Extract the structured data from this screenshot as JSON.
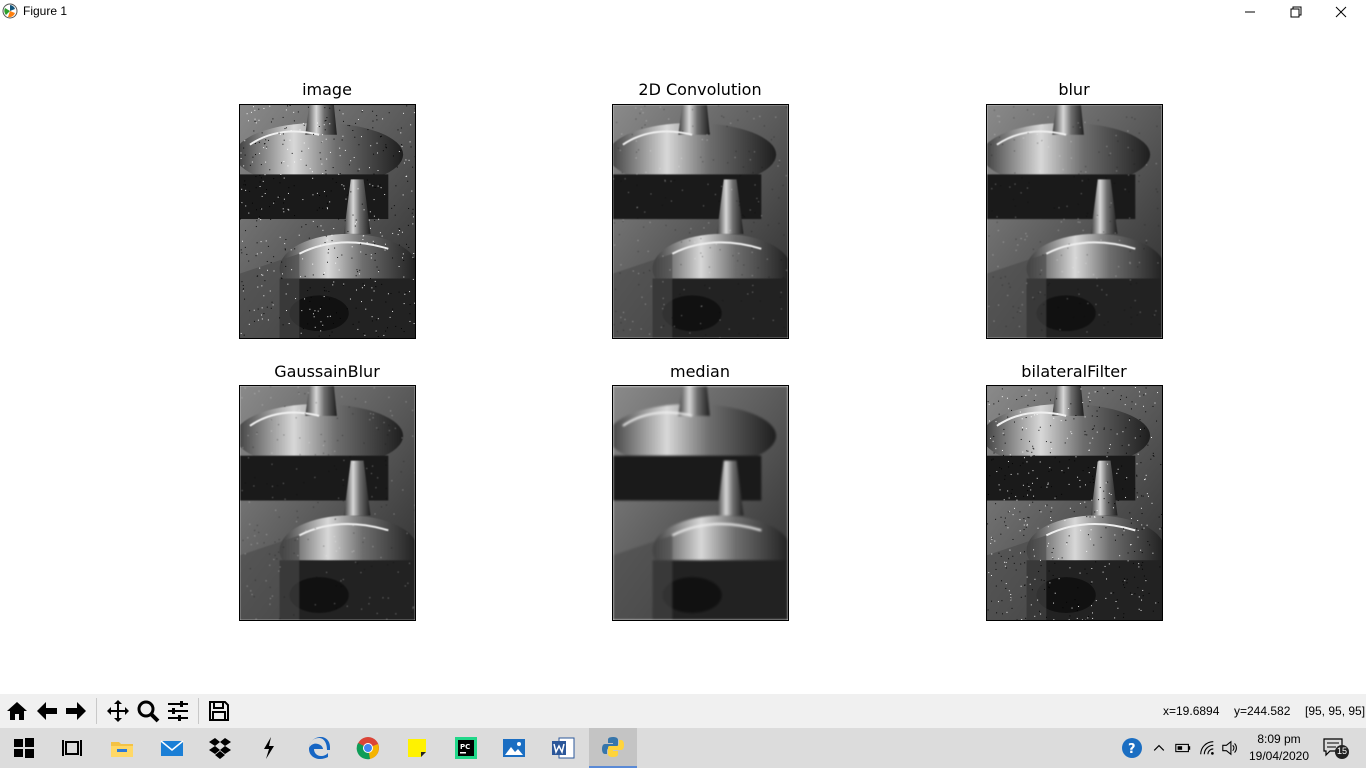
{
  "window": {
    "title": "Figure 1"
  },
  "subplots": [
    {
      "title": "image",
      "variant": "noisy"
    },
    {
      "title": "2D Convolution",
      "variant": "soft-noisy"
    },
    {
      "title": "blur",
      "variant": "soft-noisy"
    },
    {
      "title": "GaussainBlur",
      "variant": "soft-noisy"
    },
    {
      "title": "median",
      "variant": "clean"
    },
    {
      "title": "bilateralFilter",
      "variant": "noisy"
    }
  ],
  "toolbar": {
    "buttons": [
      "home-icon",
      "back-icon",
      "forward-icon",
      "pan-icon",
      "zoom-icon",
      "configure-subplots-icon",
      "save-icon"
    ],
    "status": {
      "x": "x=19.6894",
      "y": "y=244.582",
      "pixel": "[95, 95, 95]"
    }
  },
  "taskbar": {
    "apps": [
      "start-icon",
      "task-view-icon",
      "file-explorer-icon",
      "mail-icon",
      "dropbox-icon",
      "code-editor-icon",
      "edge-icon",
      "chrome-icon",
      "sticky-notes-icon",
      "pycharm-icon",
      "photos-icon",
      "word-icon",
      "python-icon"
    ],
    "clock_time": "8:09 pm",
    "clock_date": "19/04/2020",
    "notification_count": "15"
  },
  "colors": {
    "toolbar_bg": "#f0f0f0",
    "taskbar_bg": "#dcdcdc",
    "axes_border": "#000000"
  }
}
